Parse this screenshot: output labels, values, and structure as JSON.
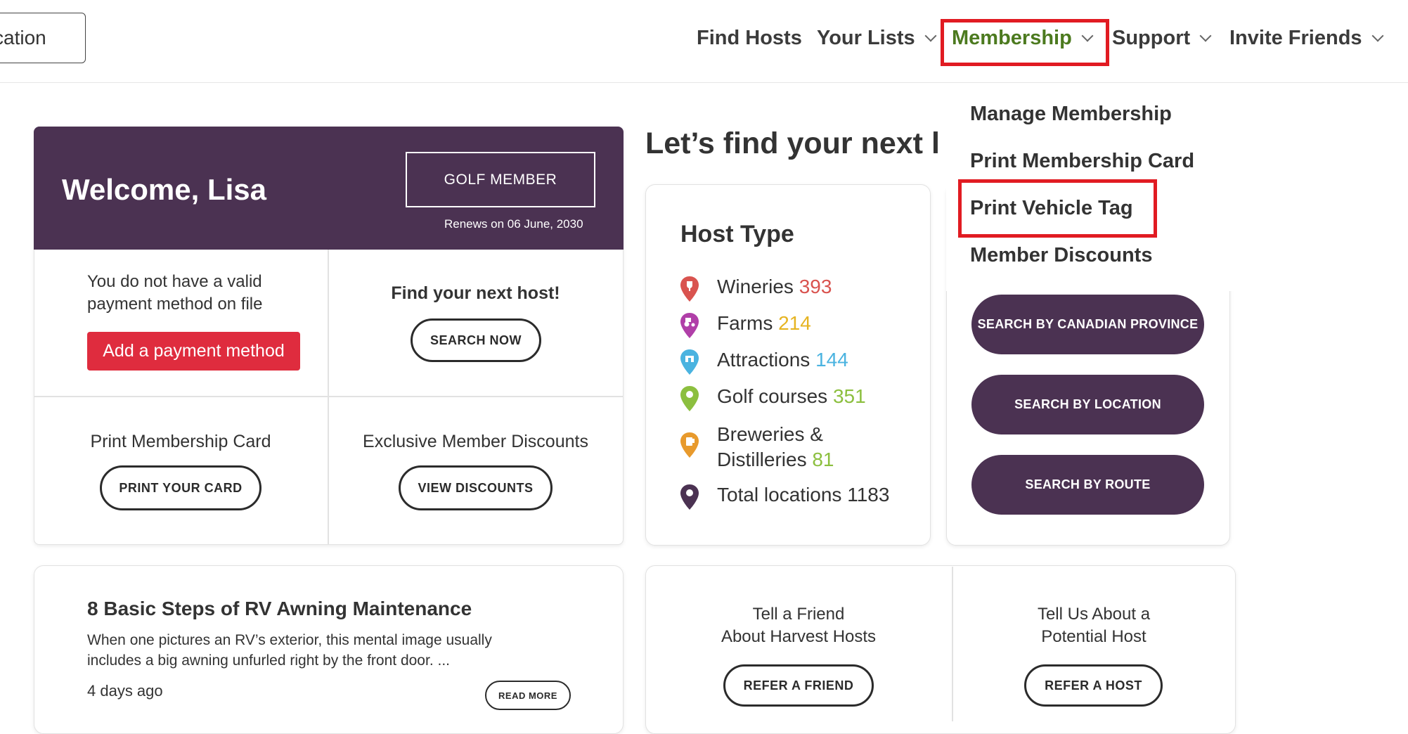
{
  "header": {
    "location_button": "cation",
    "nav": [
      {
        "label": "Find Hosts"
      },
      {
        "label": "Your Lists"
      },
      {
        "label": "Membership"
      },
      {
        "label": "Support"
      },
      {
        "label": "Invite Friends"
      }
    ]
  },
  "membership_dropdown": {
    "items": [
      "Manage Membership",
      "Print Membership Card",
      "Print Vehicle Tag",
      "Member Discounts"
    ]
  },
  "welcome": {
    "title": "Welcome, Lisa",
    "badge": "GOLF MEMBER",
    "renews": "Renews on 06 June, 2030",
    "payment_text_1": "You do not have a valid",
    "payment_text_2": "payment method on file",
    "payment_button": "Add a payment method",
    "find_host_title": "Find your next host!",
    "search_now": "SEARCH NOW",
    "print_card_label": "Print Membership Card",
    "print_card_button": "PRINT YOUR CARD",
    "discounts_label": "Exclusive Member Discounts",
    "discounts_button": "VIEW DISCOUNTS"
  },
  "find_heading": "Let’s find your next l",
  "host_type": {
    "title": "Host Type",
    "rows": [
      {
        "name": "Wineries",
        "count": "393",
        "color": "#d9534f"
      },
      {
        "name": "Farms",
        "count": "214",
        "color": "#e6b422"
      },
      {
        "name": "Attractions",
        "count": "144",
        "color": "#4ab3e0"
      },
      {
        "name": "Golf courses",
        "count": "351",
        "color": "#8cbf3f"
      },
      {
        "name_line1": "Breweries &",
        "name_line2": "Distilleries",
        "count": "81",
        "color": "#8cbf3f"
      },
      {
        "name": "Total locations",
        "count": "1183",
        "color": "#333333"
      }
    ]
  },
  "search_buttons": [
    "SEARCH BY CANADIAN PROVINCE",
    "SEARCH BY LOCATION",
    "SEARCH BY ROUTE"
  ],
  "article": {
    "title": "8 Basic Steps of RV Awning Maintenance",
    "line1": "When one pictures an RV’s exterior, this mental image usually",
    "line2": "includes a big awning unfurled right by the front door. ...",
    "age": "4 days ago",
    "button": "READ MORE"
  },
  "refer": {
    "friend_line1": "Tell a Friend",
    "friend_line2": "About Harvest Hosts",
    "friend_button": "REFER A FRIEND",
    "host_line1": "Tell Us About a",
    "host_line2": "Potential Host",
    "host_button": "REFER A HOST"
  },
  "colors": {
    "purple": "#4b3252",
    "red": "#df2c3e",
    "nav_active": "#4c7a1f",
    "highlight": "#e11b22"
  }
}
